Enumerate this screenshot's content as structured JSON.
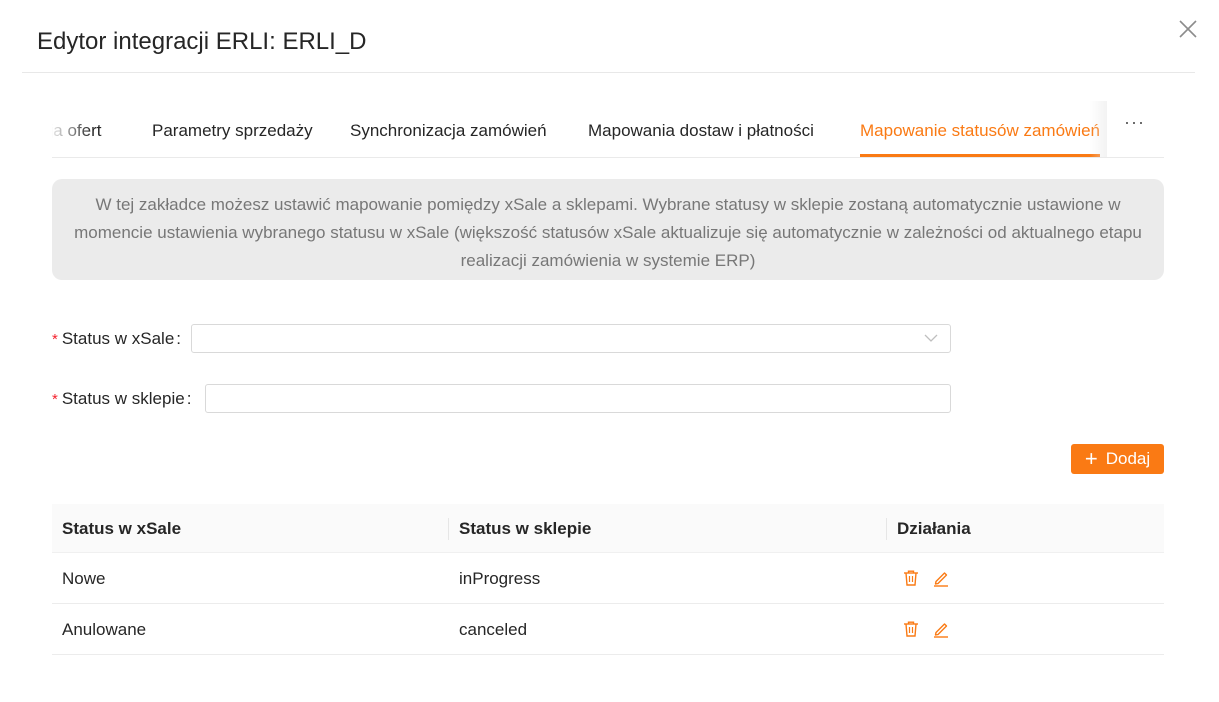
{
  "modal": {
    "title": "Edytor integracji ERLI: ERLI_D",
    "close_icon": "close-icon"
  },
  "tabs": [
    {
      "label": "cja ofert",
      "active": false
    },
    {
      "label": "Parametry sprzedaży",
      "active": false
    },
    {
      "label": "Synchronizacja zamówień",
      "active": false
    },
    {
      "label": "Mapowania dostaw i płatności",
      "active": false
    },
    {
      "label": "Mapowanie statusów zamówień",
      "active": true
    }
  ],
  "tabs_more_label": "···",
  "info": {
    "text": "W tej zakładce możesz ustawić mapowanie pomiędzy xSale a sklepami. Wybrane statusy w sklepie zostaną automatycznie ustawione w momencie ustawienia wybranego statusu w xSale (większość statusów xSale aktualizuje się automatycznie w zależności od aktualnego etapu realizacji zamówienia w systemie ERP)"
  },
  "form": {
    "required_mark": "*",
    "xsale_status_label": "Status w xSale",
    "xsale_status_value": "",
    "shop_status_label": "Status w sklepie",
    "shop_status_value": "",
    "colon": ":"
  },
  "add_button": {
    "plus": "+",
    "label": "Dodaj"
  },
  "table": {
    "headers": {
      "xsale": "Status w xSale",
      "shop": "Status w sklepie",
      "actions": "Działania"
    },
    "rows": [
      {
        "xsale": "Nowe",
        "shop": "inProgress"
      },
      {
        "xsale": "Anulowane",
        "shop": "canceled"
      }
    ]
  },
  "colors": {
    "accent": "#fa7a14",
    "required": "#f5222d",
    "info_bg": "#ebebeb",
    "info_text": "#777777"
  }
}
